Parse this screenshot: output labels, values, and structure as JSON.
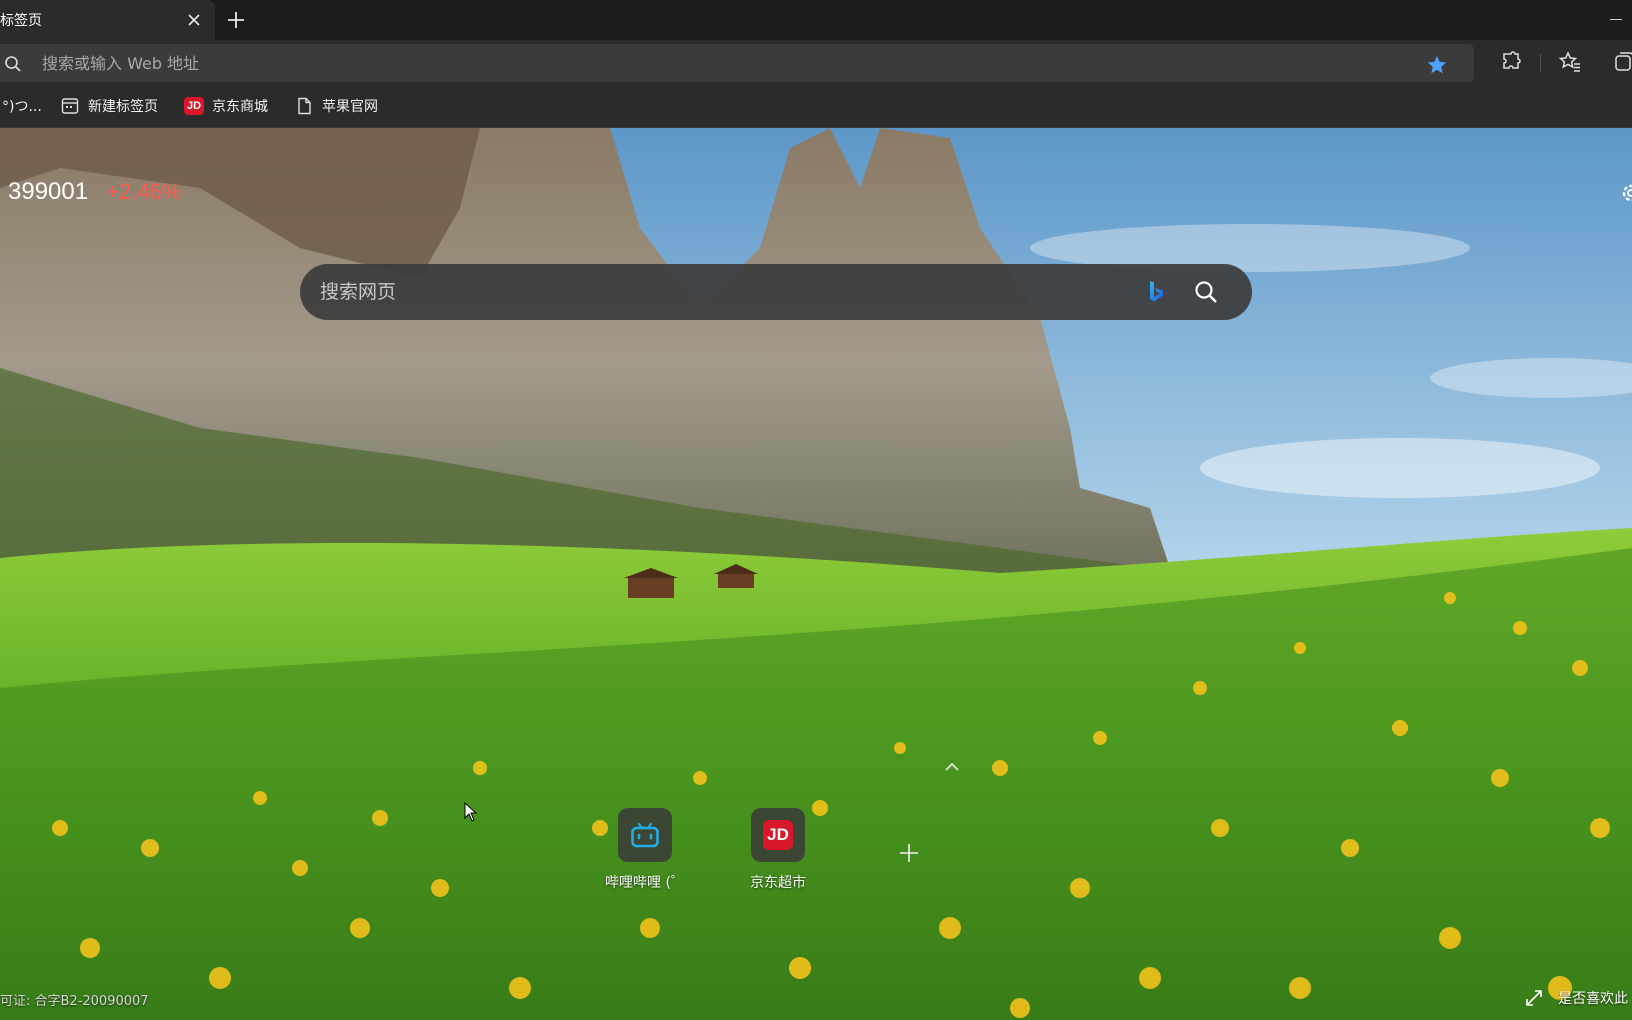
{
  "browser": {
    "tab": {
      "title": "新标签页",
      "close_icon": "close-icon"
    },
    "new_tab_icon": "plus-icon",
    "address_bar": {
      "placeholder": "搜索或输入 Web 地址",
      "value": ""
    },
    "toolbar_icons": [
      "favorite-star-icon",
      "extensions-icon",
      "favorites-icon",
      "collections-icon"
    ],
    "bookmarks": [
      {
        "label": "°)つ...",
        "icon": "none"
      },
      {
        "label": "新建标签页",
        "icon": "newtab-page-icon"
      },
      {
        "label": "京东商城",
        "icon": "jd-icon"
      },
      {
        "label": "苹果官网",
        "icon": "page-icon"
      }
    ]
  },
  "ntp": {
    "stock": {
      "code": "399001",
      "change": "+2.46%"
    },
    "search": {
      "placeholder": "搜索网页"
    },
    "quicklinks": [
      {
        "label": "哔哩哔哩 (゜",
        "icon": "bilibili-icon"
      },
      {
        "label": "京东超市",
        "icon": "jd-icon",
        "badge": "JD"
      }
    ],
    "license": "可证: 合字B2-20090007",
    "feedback": "是否喜欢此",
    "colors": {
      "stock_change": "#ff5a4e",
      "jd_red": "#d9172a",
      "bilibili_blue": "#23ade5",
      "favorite_star": "#4aa3ff"
    }
  }
}
